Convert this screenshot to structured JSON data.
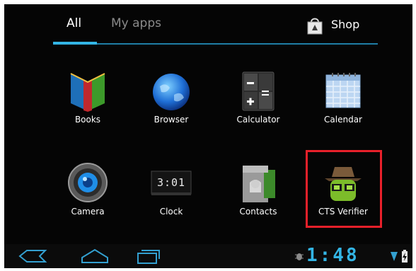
{
  "tabs": {
    "all": "All",
    "my_apps": "My apps",
    "shop": "Shop"
  },
  "apps": [
    {
      "label": "Books",
      "icon": "books-icon"
    },
    {
      "label": "Browser",
      "icon": "browser-icon"
    },
    {
      "label": "Calculator",
      "icon": "calculator-icon"
    },
    {
      "label": "Calendar",
      "icon": "calendar-icon"
    },
    {
      "label": "Camera",
      "icon": "camera-icon"
    },
    {
      "label": "Clock",
      "icon": "clock-icon"
    },
    {
      "label": "Contacts",
      "icon": "contacts-icon"
    },
    {
      "label": "CTS Verifier",
      "icon": "cts-verifier-icon"
    }
  ],
  "clock_icon_time": "3:01",
  "status": {
    "time": "1:48"
  },
  "colors": {
    "accent": "#33b5e5",
    "highlight": "#e8202a"
  }
}
